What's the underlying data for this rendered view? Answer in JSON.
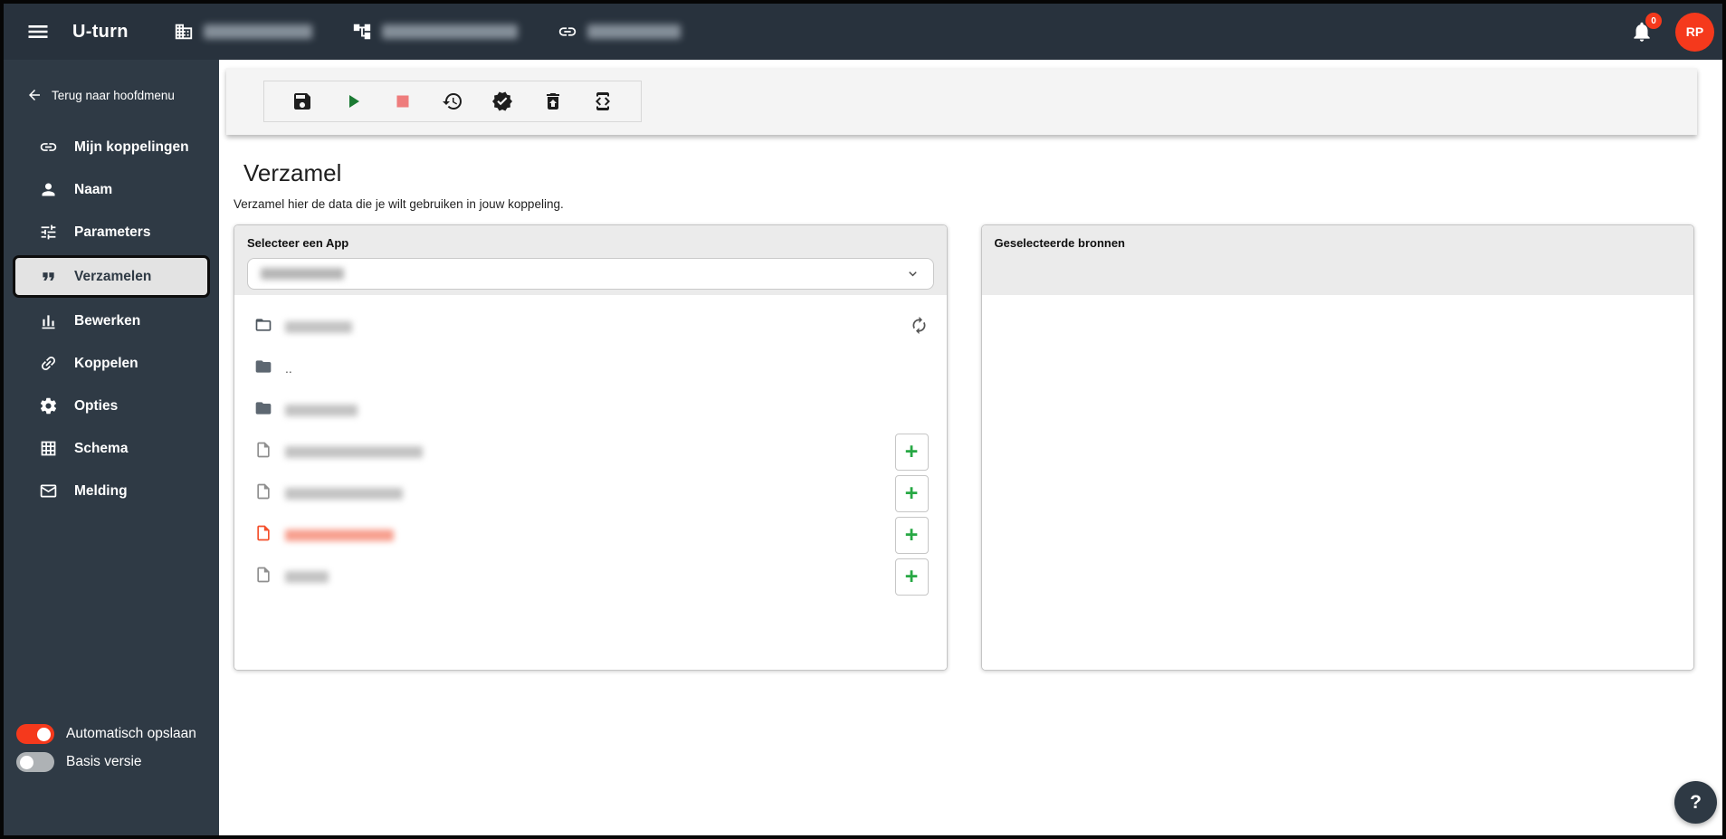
{
  "topbar": {
    "app_title": "U-turn",
    "nav_items": [
      {
        "icon": "company-icon",
        "redacted": true
      },
      {
        "icon": "environment-tree-icon",
        "redacted": true
      },
      {
        "icon": "connection-link-icon",
        "redacted": true
      }
    ],
    "notification_badge": "0",
    "avatar_initials": "RP"
  },
  "sidebar": {
    "back_label": "Terug naar hoofdmenu",
    "items": [
      {
        "label": "Mijn koppelingen",
        "icon": "link-icon",
        "selected": false
      },
      {
        "label": "Naam",
        "icon": "person-icon",
        "selected": false
      },
      {
        "label": "Parameters",
        "icon": "sliders-icon",
        "selected": false
      },
      {
        "label": "Verzamelen",
        "icon": "quote-icon",
        "selected": true
      },
      {
        "label": "Bewerken",
        "icon": "bar-chart-icon",
        "selected": false
      },
      {
        "label": "Koppelen",
        "icon": "chain-icon",
        "selected": false
      },
      {
        "label": "Opties",
        "icon": "gear-icon",
        "selected": false
      },
      {
        "label": "Schema",
        "icon": "table-grid-icon",
        "selected": false
      },
      {
        "label": "Melding",
        "icon": "envelope-icon",
        "selected": false
      }
    ],
    "toggles": [
      {
        "label": "Automatisch opslaan",
        "on": true
      },
      {
        "label": "Basis versie",
        "on": false
      }
    ]
  },
  "toolbar": {
    "buttons": [
      {
        "name": "save",
        "icon": "save-icon"
      },
      {
        "name": "run",
        "icon": "play-icon"
      },
      {
        "name": "stop",
        "icon": "stop-icon"
      },
      {
        "name": "history",
        "icon": "history-icon"
      },
      {
        "name": "validate",
        "icon": "verified-icon"
      },
      {
        "name": "delete",
        "icon": "trash-restore-icon"
      },
      {
        "name": "code",
        "icon": "developer-mode-icon"
      }
    ]
  },
  "main": {
    "title": "Verzamel",
    "subtitle": "Verzamel hier de data die je wilt gebruiken in jouw koppeling.",
    "source_panel": {
      "select_label": "Selecteer een App",
      "selected_app_redacted": true,
      "add_symbol": "+",
      "rows": [
        {
          "type": "current-dir",
          "redacted": true,
          "action": "refresh"
        },
        {
          "type": "folder-up",
          "label": "..",
          "action": null
        },
        {
          "type": "folder",
          "redacted": true,
          "action": null
        },
        {
          "type": "file",
          "redacted": true,
          "action": "add"
        },
        {
          "type": "file",
          "redacted": true,
          "action": "add"
        },
        {
          "type": "file",
          "redacted": true,
          "highlight": "red",
          "action": "add"
        },
        {
          "type": "file",
          "redacted": true,
          "action": "add"
        }
      ]
    },
    "selected_panel": {
      "title": "Geselecteerde bronnen"
    },
    "help_label": "?"
  },
  "colors": {
    "topbar_bg": "#28323d",
    "sidebar_bg": "#2f3a45",
    "accent_red": "#f5391c",
    "selected_item_bg": "#e3e3e3",
    "panel_header_bg": "#ebebeb",
    "plus_green": "#27a844",
    "play_green": "#1b7a33",
    "stop_pink": "#ee7c7c",
    "red_file": "#f4502c"
  }
}
